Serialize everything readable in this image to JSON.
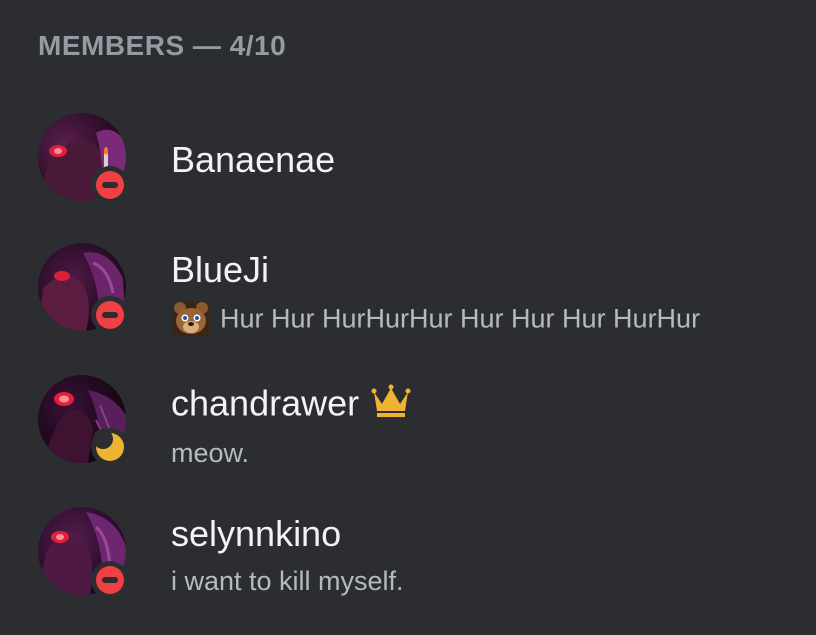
{
  "section": {
    "title": "MEMBERS — 4/10"
  },
  "members": [
    {
      "name": "Banaenae",
      "status": "dnd",
      "custom_status": ""
    },
    {
      "name": "BlueJi",
      "status": "dnd",
      "custom_status": "Hur Hur HurHurHur Hur Hur Hur HurHur",
      "status_emoji": "freddy-bear-emoji"
    },
    {
      "name": "chandrawer",
      "status": "idle",
      "custom_status": "meow.",
      "badge_icon": "crown-icon"
    },
    {
      "name": "selynnkino",
      "status": "dnd",
      "custom_status": "i want to kill myself."
    }
  ],
  "colors": {
    "background": "#2b2d31",
    "header_text": "#949ba4",
    "name_text": "#f2f3f5",
    "status_text": "#b5bac1",
    "dnd": "#f23f43",
    "idle": "#f0b232",
    "crown": "#f0b232"
  }
}
